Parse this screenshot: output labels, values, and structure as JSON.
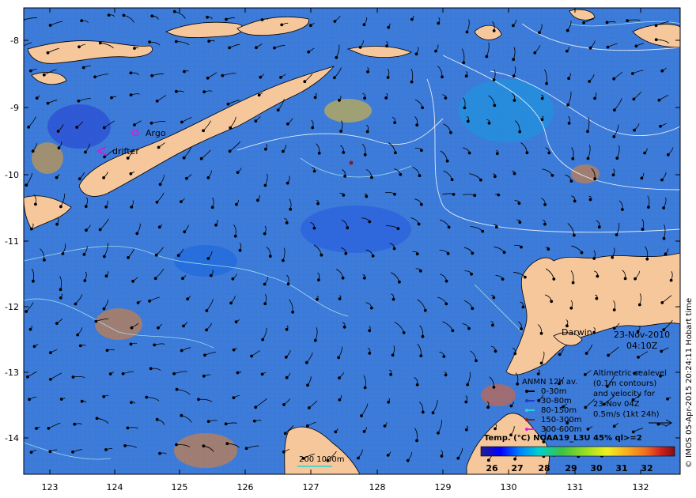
{
  "map": {
    "lat_labels": [
      "-8",
      "-9",
      "-10",
      "-11",
      "-12",
      "-13",
      "-14"
    ],
    "lon_labels": [
      "123",
      "124",
      "125",
      "126",
      "127",
      "128",
      "129",
      "130",
      "131",
      "132"
    ],
    "place_labels": {
      "argo": "Argo",
      "drifter": "drifter",
      "darwin": "Darwin"
    },
    "date": "23-Nov-2010",
    "time": "04:10Z",
    "credit": "© IMOS 05-Apr-2015 20:24:11 Hobart time"
  },
  "legend": {
    "drifter_title": "ANMN 12h av.",
    "depths": [
      {
        "label": "0-30m",
        "color": "#000000"
      },
      {
        "label": "30-80m",
        "color": "#1a3cc8"
      },
      {
        "label": "80-150m",
        "color": "#28d4d4"
      },
      {
        "label": "150-300m",
        "color": "#8b1a1a"
      },
      {
        "label": "300-600m",
        "color": "#e020e0"
      }
    ],
    "altimetry_lines": [
      "Altimetric sealevel",
      "(0.1m contours)",
      "and velocity for",
      "23-Nov 04Z",
      "0.5m/s (1kt 24h)"
    ],
    "depth_contours": "200  1000m",
    "colorbar_title": "Temp. (°C) NOAA19_L3U 45% ql>=2",
    "colorbar_ticks": [
      "26",
      "27",
      "28",
      "29",
      "30",
      "31",
      "32"
    ]
  },
  "colors": {
    "land": "#f7c79c",
    "argo": "#d81bd8",
    "contour": "#bfe8f0",
    "colorbar": [
      "#20208f",
      "#0000ff",
      "#0080ff",
      "#00d0d0",
      "#40c040",
      "#a0e020",
      "#f0f020",
      "#f8b020",
      "#f07020",
      "#d02020",
      "#801010"
    ]
  }
}
